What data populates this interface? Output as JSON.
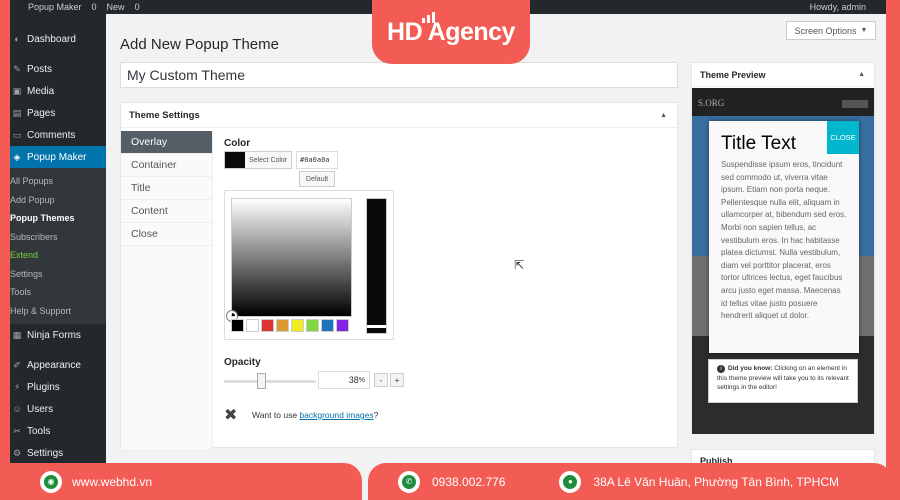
{
  "adminbar": {
    "site": "Popup Maker",
    "comments": "0",
    "new": "New",
    "updates": "0",
    "user": "Howdy, admin"
  },
  "sidebar": {
    "items_top": [
      {
        "label": "Dashboard",
        "icon": "dashboard-icon"
      },
      {
        "label": "Posts",
        "icon": "pin-icon"
      },
      {
        "label": "Media",
        "icon": "media-icon"
      },
      {
        "label": "Pages",
        "icon": "page-icon"
      },
      {
        "label": "Comments",
        "icon": "comment-icon"
      },
      {
        "label": "Popup Maker",
        "icon": "popup-icon"
      }
    ],
    "submenu": [
      "All Popups",
      "Add Popup",
      "Popup Themes",
      "Subscribers",
      "Extend",
      "Settings",
      "Tools",
      "Help & Support"
    ],
    "items_bottom": [
      {
        "label": "Ninja Forms",
        "icon": "form-icon"
      },
      {
        "label": "Appearance",
        "icon": "brush-icon"
      },
      {
        "label": "Plugins",
        "icon": "plugin-icon"
      },
      {
        "label": "Users",
        "icon": "user-icon"
      },
      {
        "label": "Tools",
        "icon": "wrench-icon"
      },
      {
        "label": "Settings",
        "icon": "gear-icon"
      }
    ]
  },
  "header": {
    "title": "Add New Popup Theme",
    "screen_options": "Screen Options"
  },
  "theme_name": "My Custom Theme",
  "settings": {
    "title": "Theme Settings",
    "tabs": [
      "Overlay",
      "Container",
      "Title",
      "Content",
      "Close"
    ],
    "color_label": "Color",
    "select_color": "Select Color",
    "hex_value": "#0a0a0a",
    "default_btn": "Default",
    "palette": [
      "#000000",
      "#ffffff",
      "#dd3333",
      "#dd9933",
      "#eeee22",
      "#81d742",
      "#1e73be",
      "#8224e3"
    ],
    "opacity_label": "Opacity",
    "opacity_value": "38",
    "opacity_unit": "%",
    "minus": "-",
    "plus": "+",
    "bg_prefix": "Want to use ",
    "bg_link": "background images",
    "bg_suffix": "?"
  },
  "preview": {
    "title": "Theme Preview",
    "site_logo": "S.ORG",
    "popup_title": "Title Text",
    "close_label": "CLOSE",
    "popup_body": "Suspendisse ipsum eros, tincidunt sed commodo ut, viverra vitae ipsum. Etiam non porta neque. Pellentesque nulla elit, aliquam in ullamcorper at, bibendum sed eros. Morbi non sapien tellus, ac vestibulum eros. In hac habitasse platea dictumst. Nulla vestibulum, diam vel porttitor placerat, eros tortor ultrices lectus, eget faucibus arcu justo eget massa. Maecenas id tellus vitae justo posuere hendrerit aliquet ut dolor.",
    "tip_bold": "Did you know:",
    "tip_text": " Clicking on an element in this theme preview will take you to its relevant settings in the editor!"
  },
  "publish": {
    "title": "Publish"
  },
  "brand": {
    "name": "HD Agency"
  },
  "footer": {
    "website": "www.webhd.vn",
    "phone": "0938.002.776",
    "address": "38A Lê Văn Huân, Phường Tân Bình, TPHCM"
  }
}
